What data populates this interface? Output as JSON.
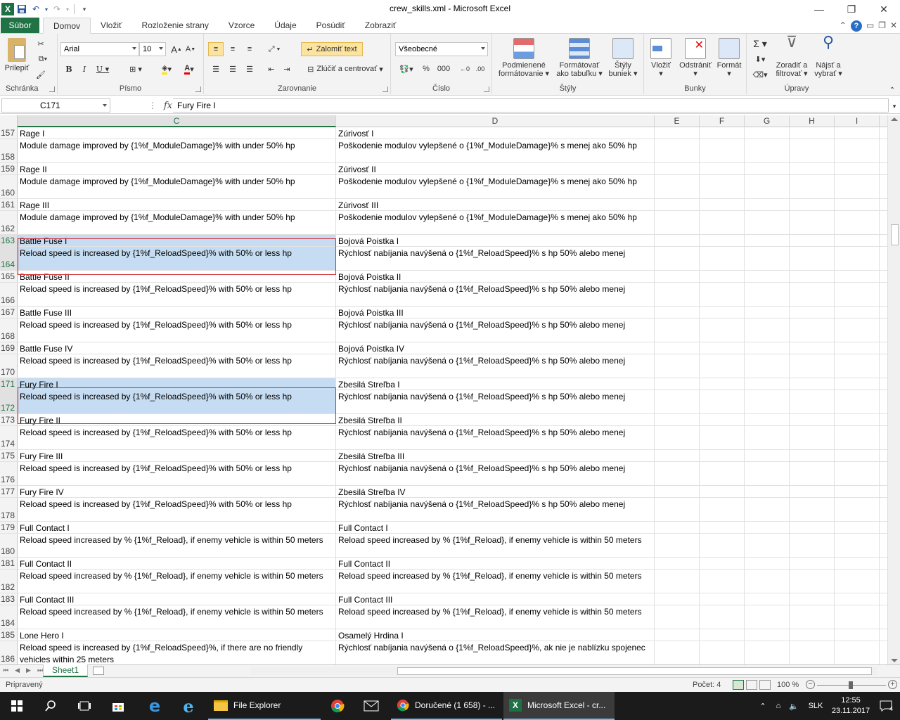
{
  "window": {
    "title": "crew_skills.xml  -  Microsoft Excel",
    "minimize_glyph": "—",
    "restore_glyph": "❐",
    "close_glyph": "✕"
  },
  "ribbon_tabs": [
    "Súbor",
    "Domov",
    "Vložiť",
    "Rozloženie strany",
    "Vzorce",
    "Údaje",
    "Posúdiť",
    "Zobraziť"
  ],
  "ribbon": {
    "clipboard": {
      "paste": "Prilepiť",
      "label": "Schránka"
    },
    "font": {
      "name": "Arial",
      "size": "10",
      "label": "Písmo"
    },
    "alignment": {
      "wrap": "Zalomiť text",
      "merge": "Zlúčiť a centrovať",
      "label": "Zarovnanie"
    },
    "number": {
      "format": "Všeobecné",
      "percent": "%",
      "thousands": "000",
      "label": "Číslo"
    },
    "styles": {
      "conditional_1": "Podmienené",
      "conditional_2": "formátovanie",
      "table_1": "Formátovať",
      "table_2": "ako tabuľku",
      "cell_1": "Štýly",
      "cell_2": "buniek",
      "label": "Štýly"
    },
    "cells": {
      "insert": "Vložiť",
      "delete": "Odstrániť",
      "format": "Formát",
      "label": "Bunky"
    },
    "editing": {
      "sort_1": "Zoradiť a",
      "sort_2": "filtrovať",
      "find_1": "Nájsť a",
      "find_2": "vybrať",
      "label": "Úpravy"
    }
  },
  "formula_bar": {
    "name_box": "C171",
    "fx": "fx",
    "content": "Fury Fire I"
  },
  "columns": [
    "C",
    "D",
    "E",
    "F",
    "G",
    "H",
    "I"
  ],
  "rows": [
    {
      "n": "157",
      "c": "Rage I",
      "d": "Zúrivosť I"
    },
    {
      "n": "158",
      "c": "Module damage improved by {1%f_ModuleDamage}% with under 50% hp",
      "d": "Poškodenie modulov vylepšené o {1%f_ModuleDamage}% s menej ako 50% hp"
    },
    {
      "n": "159",
      "c": "Rage II",
      "d": "Zúrivosť II"
    },
    {
      "n": "160",
      "c": "Module damage improved by {1%f_ModuleDamage}% with under 50% hp",
      "d": "Poškodenie modulov vylepšené o {1%f_ModuleDamage}% s menej ako 50% hp"
    },
    {
      "n": "161",
      "c": "Rage III",
      "d": "Zúrivosť III"
    },
    {
      "n": "162",
      "c": "Module damage improved by {1%f_ModuleDamage}% with under 50% hp",
      "d": "Poškodenie modulov vylepšené o {1%f_ModuleDamage}% s menej ako 50% hp"
    },
    {
      "n": "163",
      "c": "Battle Fuse I",
      "d": "Bojová Poistka I"
    },
    {
      "n": "164",
      "c": "Reload speed is increased by {1%f_ReloadSpeed}% with 50% or less hp",
      "d": "Rýchlosť nabíjania navýšená o {1%f_ReloadSpeed}% s hp 50% alebo menej"
    },
    {
      "n": "165",
      "c": "Battle Fuse II",
      "d": "Bojová Poistka II"
    },
    {
      "n": "166",
      "c": "Reload speed is increased by {1%f_ReloadSpeed}% with 50% or less hp",
      "d": "Rýchlosť nabíjania navýšená o {1%f_ReloadSpeed}% s hp 50% alebo menej"
    },
    {
      "n": "167",
      "c": "Battle Fuse III",
      "d": "Bojová Poistka III"
    },
    {
      "n": "168",
      "c": "Reload speed is increased by {1%f_ReloadSpeed}% with 50% or less hp",
      "d": "Rýchlosť nabíjania navýšená o {1%f_ReloadSpeed}% s hp 50% alebo menej"
    },
    {
      "n": "169",
      "c": "Battle Fuse IV",
      "d": "Bojová Poistka IV"
    },
    {
      "n": "170",
      "c": "Reload speed is increased by {1%f_ReloadSpeed}% with 50% or less hp",
      "d": "Rýchlosť nabíjania navýšená o {1%f_ReloadSpeed}% s hp 50% alebo menej"
    },
    {
      "n": "171",
      "c": "Fury Fire I",
      "d": "Zbesilá Streľba I"
    },
    {
      "n": "172",
      "c": "Reload speed is increased by {1%f_ReloadSpeed}% with 50% or less hp",
      "d": "Rýchlosť nabíjania navýšená o {1%f_ReloadSpeed}% s hp 50% alebo menej"
    },
    {
      "n": "173",
      "c": "Fury Fire II",
      "d": "Zbesilá Streľba II"
    },
    {
      "n": "174",
      "c": "Reload speed is increased by {1%f_ReloadSpeed}% with 50% or less hp",
      "d": "Rýchlosť nabíjania navýšená o {1%f_ReloadSpeed}% s hp 50% alebo menej"
    },
    {
      "n": "175",
      "c": "Fury Fire III",
      "d": "Zbesilá Streľba III"
    },
    {
      "n": "176",
      "c": "Reload speed is increased by {1%f_ReloadSpeed}% with 50% or less hp",
      "d": "Rýchlosť nabíjania navýšená o {1%f_ReloadSpeed}% s hp 50% alebo menej"
    },
    {
      "n": "177",
      "c": "Fury Fire IV",
      "d": "Zbesilá Streľba IV"
    },
    {
      "n": "178",
      "c": "Reload speed is increased by {1%f_ReloadSpeed}% with 50% or less hp",
      "d": "Rýchlosť nabíjania navýšená o {1%f_ReloadSpeed}% s hp 50% alebo menej"
    },
    {
      "n": "179",
      "c": "Full Contact I",
      "d": "Full Contact I"
    },
    {
      "n": "180",
      "c": "Reload speed increased by % {1%f_Reload}, if enemy vehicle is within 50 meters",
      "d": "Reload speed increased by % {1%f_Reload}, if enemy vehicle is within 50 meters"
    },
    {
      "n": "181",
      "c": "Full Contact II",
      "d": "Full Contact II"
    },
    {
      "n": "182",
      "c": "Reload speed increased by % {1%f_Reload}, if enemy vehicle is within 50 meters",
      "d": "Reload speed increased by % {1%f_Reload}, if enemy vehicle is within 50 meters"
    },
    {
      "n": "183",
      "c": "Full Contact III",
      "d": "Full Contact III"
    },
    {
      "n": "184",
      "c": "Reload speed increased by % {1%f_Reload}, if enemy vehicle is within 50 meters",
      "d": "Reload speed increased by % {1%f_Reload}, if enemy vehicle is within 50 meters"
    },
    {
      "n": "185",
      "c": "Lone Hero I",
      "d": "Osamelý Hrdina I"
    },
    {
      "n": "186",
      "c": "Reload speed is increased by {1%f_ReloadSpeed}%, if there are no friendly vehicles within 25 meters",
      "d": "Rýchlosť nabíjania navýšená o {1%f_ReloadSpeed}%, ak nie je nablízku spojenec"
    }
  ],
  "sheet_tab": "Sheet1",
  "status": {
    "ready": "Pripravený",
    "count": "Počet: 4",
    "zoom": "100 %"
  },
  "taskbar": {
    "file_explorer": "File Explorer",
    "mail": "Doručené (1 658) - ...",
    "excel": "Microsoft Excel - cr...",
    "lang": "SLK",
    "time": "12:55",
    "date": "23.11.2017",
    "notifications": "4"
  }
}
